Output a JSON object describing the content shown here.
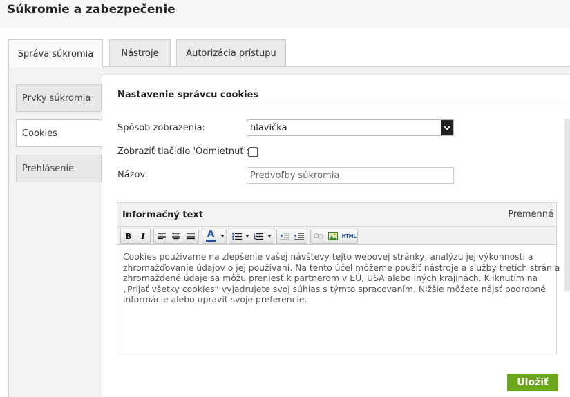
{
  "page": {
    "title": "Súkromie a zabezpečenie"
  },
  "tabs": [
    {
      "label": "Správa súkromia",
      "active": true
    },
    {
      "label": "Nástroje",
      "active": false
    },
    {
      "label": "Autorizácia prístupu",
      "active": false
    }
  ],
  "sidebar": {
    "items": [
      {
        "label": "Prvky súkromia",
        "active": false
      },
      {
        "label": "Cookies",
        "active": true
      },
      {
        "label": "Prehlásenie",
        "active": false
      }
    ]
  },
  "section": {
    "title": "Nastavenie správcu cookies"
  },
  "form": {
    "display_mode_label": "Spôsob zobrazenia:",
    "display_mode_value": "hlavička",
    "reject_button_label": "Zobraziť tlačidlo 'Odmietnuť':",
    "reject_button_checked": false,
    "name_label": "Názov:",
    "name_value": "Predvoľby súkromia"
  },
  "info": {
    "title": "Informačný text",
    "variables_link": "Premenné",
    "toolbar": {
      "bold": "B",
      "italic": "I",
      "font_color": "A",
      "html": "HTML"
    },
    "text_lines": [
      "Cookies používame na zlepšenie vašej návštevy tejto webovej stránky, analýzu jej výkonnosti a",
      "zhromažďovanie údajov o jej používaní. Na tento účel môžeme použiť nástroje a služby tretích strán a",
      "zhromaždené údaje sa môžu preniesť k partnerom v EÚ, USA alebo iných krajinách. Kliknutím na",
      "„Prijať všetky cookies“ vyjadrujete svoj súhlas s týmto spracovaním. Nižšie môžete nájsť podrobné",
      "informácie alebo upraviť svoje preferencie."
    ]
  },
  "actions": {
    "save_label": "Uložiť"
  },
  "colors": {
    "accent_green": "#6aa51d",
    "font_color_blue": "#1f4e9c"
  }
}
